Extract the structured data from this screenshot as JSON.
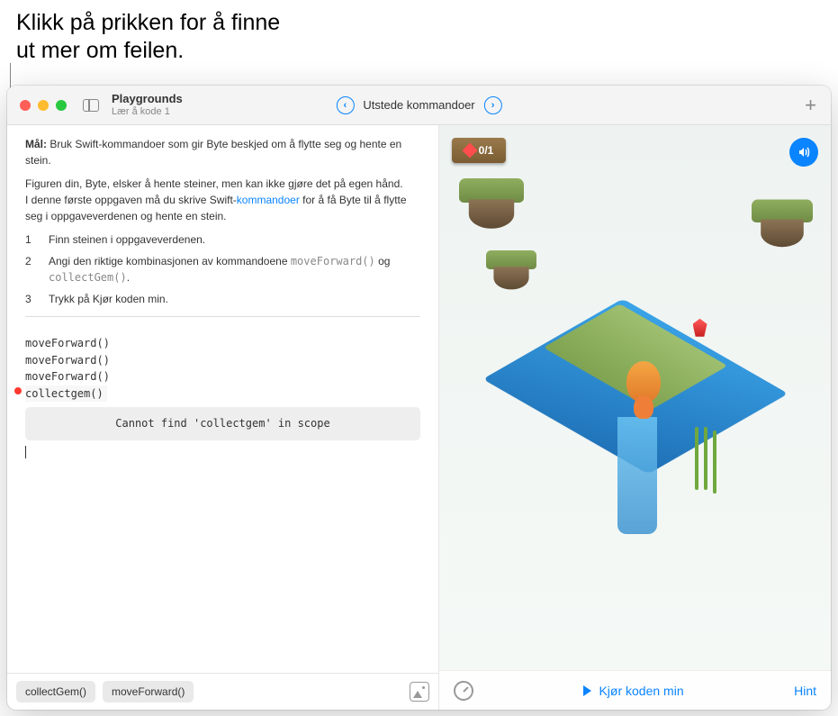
{
  "annotation": {
    "line1": "Klikk på prikken for å finne",
    "line2": "ut mer om feilen."
  },
  "titlebar": {
    "app_title": "Playgrounds",
    "subtitle": "Lær å kode 1",
    "page_title": "Utstede kommandoer"
  },
  "instructions": {
    "goal_label": "Mål:",
    "goal_text": " Bruk Swift-kommandoer som gir Byte beskjed om å flytte seg og hente en stein.",
    "intro1": "Figuren din, Byte, elsker å hente steiner, men kan ikke gjøre det på egen hånd.",
    "intro2_a": "I denne første oppgaven må du skrive Swift-",
    "intro2_link": "kommandoer",
    "intro2_b": " for å få Byte til å flytte seg i oppgaveverdenen og hente en stein.",
    "steps": [
      {
        "num": "1",
        "text": "Finn steinen i oppgaveverdenen."
      },
      {
        "num": "2",
        "text_a": "Angi den riktige kombinasjonen av kommandoene ",
        "code1": "moveForward()",
        "text_b": " og ",
        "code2": "collectGem()",
        "text_c": "."
      },
      {
        "num": "3",
        "text": "Trykk på Kjør koden min."
      }
    ]
  },
  "code": {
    "lines": [
      "moveForward()",
      "moveForward()",
      "moveForward()",
      "collectgem()"
    ],
    "error_message": "Cannot find 'collectgem' in scope"
  },
  "suggestions": {
    "chips": [
      "collectGem()",
      "moveForward()"
    ]
  },
  "game": {
    "score": "0/1"
  },
  "toolbar": {
    "run_label": "Kjør koden min",
    "hint_label": "Hint"
  }
}
